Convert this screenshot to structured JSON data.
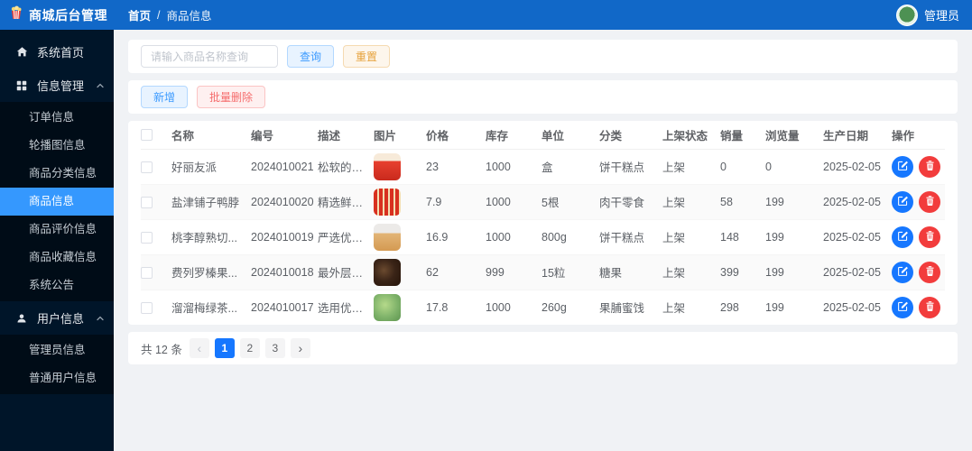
{
  "header": {
    "logo_icon": "popcorn-icon",
    "title": "商城后台管理",
    "breadcrumb": {
      "home": "首页",
      "separator": "/",
      "current": "商品信息"
    },
    "user": "管理员",
    "bg_color": "#1168c8"
  },
  "sidebar": {
    "bg_color": "#001529",
    "submenu_bg_color": "#000c17",
    "active_color": "#3598fe",
    "items": [
      {
        "label": "系统首页",
        "icon": "home-icon"
      },
      {
        "label": "信息管理",
        "icon": "grid-icon",
        "expanded": true,
        "caret_icon": "chevron-up-icon",
        "children": [
          "订单信息",
          "轮播图信息",
          "商品分类信息",
          "商品信息",
          "商品评价信息",
          "商品收藏信息",
          "系统公告"
        ],
        "active_child": "商品信息"
      },
      {
        "label": "用户信息",
        "icon": "user-icon",
        "expanded": true,
        "caret_icon": "chevron-up-icon",
        "children": [
          "管理员信息",
          "普通用户信息"
        ]
      }
    ]
  },
  "toolbar": {
    "search_placeholder": "请输入商品名称查询",
    "search_label": "查询",
    "reset_label": "重置",
    "add_label": "新增",
    "batch_delete_label": "批量删除"
  },
  "table": {
    "columns": [
      "名称",
      "编号",
      "描述",
      "图片",
      "价格",
      "库存",
      "单位",
      "分类",
      "上架状态",
      "销量",
      "浏览量",
      "生产日期",
      "操作"
    ],
    "edit_color": "#1677ff",
    "delete_color": "#f23c3c",
    "rows": [
      {
        "name": "好丽友派",
        "code": "2024010021",
        "desc": "松软的蛋糕...",
        "image": "red-pie-box-photo",
        "thumb_style": "linear-gradient(180deg,#f7ead9 0%,#f7ead9 28%,#e8402f 28%,#c92a1d 100%)",
        "price": "23",
        "stock": "1000",
        "unit": "盒",
        "category": "饼干糕点",
        "status": "上架",
        "sales": "0",
        "views": "0",
        "date": "2025-02-05"
      },
      {
        "name": "盐津铺子鸭脖",
        "code": "2024010020",
        "desc": "精选鲜嫩鸭...",
        "image": "red-duck-neck-packs-photo",
        "thumb_style": "repeating-linear-gradient(90deg,#d8301f 0px,#d8301f 4px,#f3dfb2 4px,#f3dfb2 6px)",
        "price": "7.9",
        "stock": "1000",
        "unit": "5根",
        "category": "肉干零食",
        "status": "上架",
        "sales": "58",
        "views": "199",
        "date": "2025-02-05"
      },
      {
        "name": "桃李醇熟切...",
        "code": "2024010019",
        "desc": "严选优质小...",
        "image": "sliced-bread-photo",
        "thumb_style": "linear-gradient(180deg,#eceae8 0%,#eceae8 35%,#e3b577 35%,#d49a52 100%)",
        "price": "16.9",
        "stock": "1000",
        "unit": "800g",
        "category": "饼干糕点",
        "status": "上架",
        "sales": "148",
        "views": "199",
        "date": "2025-02-05"
      },
      {
        "name": "费列罗榛果...",
        "code": "2024010018",
        "desc": "最外层是香...",
        "image": "dark-chocolate-box-photo",
        "thumb_style": "radial-gradient(circle at 38% 42%,#6b4a2f 0%,#3a2417 48%,#241309 100%)",
        "price": "62",
        "stock": "999",
        "unit": "15粒",
        "category": "糖果",
        "status": "上架",
        "sales": "399",
        "views": "199",
        "date": "2025-02-05"
      },
      {
        "name": "溜溜梅绿茶...",
        "code": "2024010017",
        "desc": "选用优质青...",
        "image": "green-plum-tea-photo",
        "thumb_style": "radial-gradient(circle at 42% 40%,#b5d98a 0%,#7fb36a 55%,#5e9550 100%)",
        "price": "17.8",
        "stock": "1000",
        "unit": "260g",
        "category": "果脯蜜饯",
        "status": "上架",
        "sales": "298",
        "views": "199",
        "date": "2025-02-05"
      }
    ]
  },
  "pagination": {
    "total_label": "共 12 条",
    "prev_icon": "chevron-left-icon",
    "next_icon": "chevron-right-icon",
    "pages": [
      "1",
      "2",
      "3"
    ],
    "active_page": "1",
    "active_color": "#1677ff"
  }
}
